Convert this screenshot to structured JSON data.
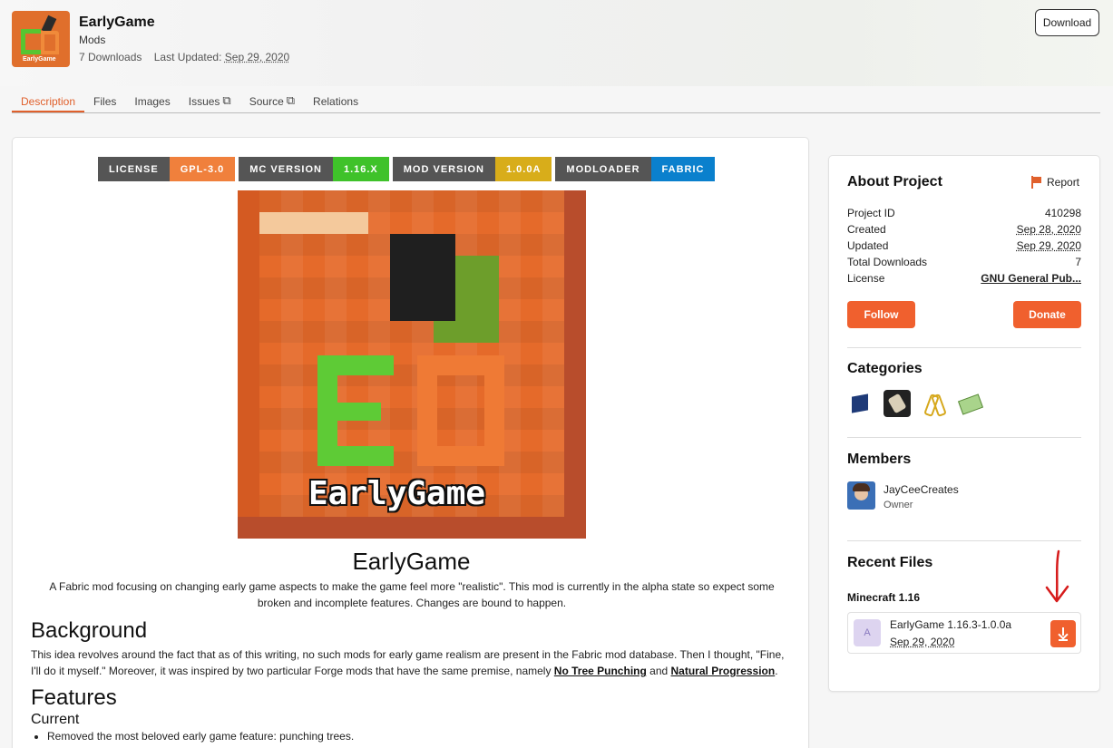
{
  "project": {
    "title": "EarlyGame",
    "type": "Mods",
    "downloads": "7 Downloads",
    "last_updated_label": "Last Updated:",
    "last_updated": "Sep 29, 2020",
    "download_label": "Download",
    "avatar_text": "EarlyGame"
  },
  "tabs": [
    {
      "label": "Description",
      "active": true,
      "external": false
    },
    {
      "label": "Files",
      "active": false,
      "external": false
    },
    {
      "label": "Images",
      "active": false,
      "external": false
    },
    {
      "label": "Issues",
      "active": false,
      "external": true
    },
    {
      "label": "Source",
      "active": false,
      "external": true
    },
    {
      "label": "Relations",
      "active": false,
      "external": false
    }
  ],
  "badges": [
    {
      "key": "LICENSE",
      "value": "GPL-3.0",
      "color": "#f0803c"
    },
    {
      "key": "MC VERSION",
      "value": "1.16.X",
      "color": "#3fc22a"
    },
    {
      "key": "MOD VERSION",
      "value": "1.0.0A",
      "color": "#d8ad1a"
    },
    {
      "key": "MODLOADER",
      "value": "FABRIC",
      "color": "#0a80cd"
    }
  ],
  "description": {
    "hero_word": "EarlyGame",
    "title": "EarlyGame",
    "summary": "A Fabric mod focusing on changing early game aspects to make the game feel more \"realistic\". This mod is currently in the alpha state so expect some broken and incomplete features. Changes are bound to happen.",
    "background_heading": "Background",
    "background_text_1": "This idea revolves around the fact that as of this writing, no such mods for early game realism are present in the Fabric mod database. Then I thought, \"Fine, I'll do it myself.\" Moreover, it was inspired by two particular Forge mods that have the same premise, namely ",
    "link_1": "No Tree Punching",
    "background_and": " and ",
    "link_2": "Natural Progression",
    "background_end": ".",
    "features_heading": "Features",
    "current_heading": "Current",
    "current_items": [
      "Removed the most beloved early game feature: punching trees."
    ]
  },
  "sidebar": {
    "about_title": "About Project",
    "report_label": "Report",
    "info": [
      {
        "label": "Project ID",
        "value": "410298",
        "style": "plain"
      },
      {
        "label": "Created",
        "value": "Sep 28, 2020",
        "style": "dotted"
      },
      {
        "label": "Updated",
        "value": "Sep 29, 2020",
        "style": "dotted"
      },
      {
        "label": "Total Downloads",
        "value": "7",
        "style": "plain"
      },
      {
        "label": "License",
        "value": "GNU General Pub...",
        "style": "link"
      }
    ],
    "follow_label": "Follow",
    "donate_label": "Donate",
    "categories_title": "Categories",
    "categories": [
      "cube-icon",
      "scroll-icon",
      "tool-icon",
      "map-icon"
    ],
    "members_title": "Members",
    "member": {
      "name": "JayCeeCreates",
      "role": "Owner"
    },
    "recent_files_title": "Recent Files",
    "mc_version": "Minecraft 1.16",
    "file": {
      "type_letter": "A",
      "name": "EarlyGame 1.16.3-1.0.0a",
      "date": "Sep 29, 2020"
    }
  },
  "colors": {
    "accent": "#f0602e",
    "annotation": "#d61b1b"
  }
}
